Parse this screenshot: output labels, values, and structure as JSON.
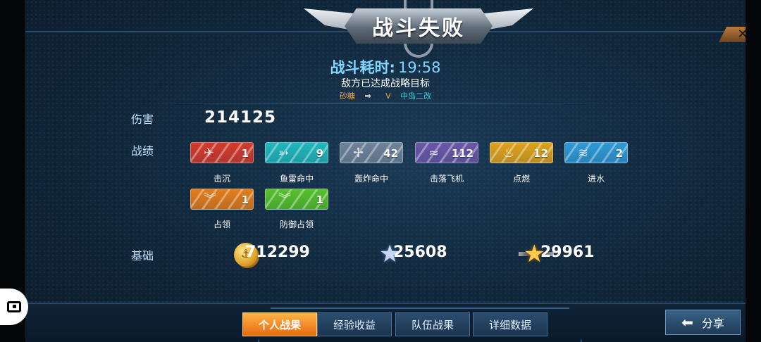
{
  "title_banner": "战斗失败",
  "close_label": "✕",
  "battle": {
    "time_label": "战斗耗时:",
    "time_value": "19:58",
    "goal_text": "敌方已达成战略目标",
    "player": "砂糖",
    "arrow": "⇒",
    "vs": "V",
    "enemy": "中岛二改"
  },
  "damage": {
    "label": "伤害",
    "value": "214125"
  },
  "achievements": {
    "label": "战绩",
    "items": [
      {
        "name": "击沉",
        "count": "1",
        "color": "#d63a2c",
        "icon": "ship-sink-icon",
        "glyph": "✈"
      },
      {
        "name": "鱼雷命中",
        "count": "9",
        "color": "#21b7bd",
        "icon": "torpedo-icon",
        "glyph": "➳"
      },
      {
        "name": "轰炸命中",
        "count": "42",
        "color": "#6f829a",
        "icon": "bomb-hit-icon",
        "glyph": "✢"
      },
      {
        "name": "击落飞机",
        "count": "112",
        "color": "#6a56a8",
        "icon": "plane-shot-icon",
        "glyph": "≈"
      },
      {
        "name": "点燃",
        "count": "12",
        "color": "#e0a319",
        "icon": "fire-icon",
        "glyph": "♨"
      },
      {
        "name": "进水",
        "count": "2",
        "color": "#2f9ad6",
        "icon": "flooding-icon",
        "glyph": "≋"
      },
      {
        "name": "占领",
        "count": "1",
        "color": "#e57d1a",
        "icon": "capture-icon",
        "glyph": "︾"
      },
      {
        "name": "防御占领",
        "count": "1",
        "color": "#57c12c",
        "icon": "defend-capture-icon",
        "glyph": "︾"
      }
    ]
  },
  "base": {
    "label": "基础",
    "coins": "712299",
    "silver_xp": "25608",
    "gold_xp": "29961",
    "coin_glyph": "⚓",
    "star_glyph": "★"
  },
  "tabs": [
    {
      "label": "个人战果",
      "active": true
    },
    {
      "label": "经验收益",
      "active": false
    },
    {
      "label": "队伍战果",
      "active": false
    },
    {
      "label": "详细数据",
      "active": false
    }
  ],
  "share": {
    "label": "分享",
    "arrow": "⬅"
  }
}
